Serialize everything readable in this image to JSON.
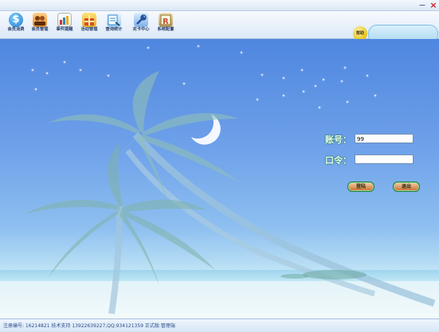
{
  "window": {
    "minimize_label": "−",
    "close_label": "×"
  },
  "toolbar": {
    "items": [
      {
        "label": "会员消费",
        "icon": "dollar-icon",
        "color": "#1e7bd0"
      },
      {
        "label": "会员管理",
        "icon": "members-icon",
        "color": "#e08a2a"
      },
      {
        "label": "事件提醒",
        "icon": "chart-icon",
        "color": "#c83a2a"
      },
      {
        "label": "活动管理",
        "icon": "gift-icon",
        "color": "#e8b020"
      },
      {
        "label": "查询统计",
        "icon": "query-icon",
        "color": "#2f86c9"
      },
      {
        "label": "充卡中心",
        "icon": "recharge-icon",
        "color": "#3a78c8"
      },
      {
        "label": "系统配置",
        "icon": "settings-icon",
        "color": "#8a6a2a"
      }
    ],
    "help_label": "帮助",
    "search_value": ""
  },
  "login": {
    "account_label": "账号：",
    "account_value": "99",
    "password_label": "口令：",
    "password_value": "",
    "login_button": "登陆",
    "exit_button": "退出"
  },
  "status": {
    "text": "注册编号: 16214821 技术支持 13922639227,QQ:934121359 正式版:管理端"
  }
}
